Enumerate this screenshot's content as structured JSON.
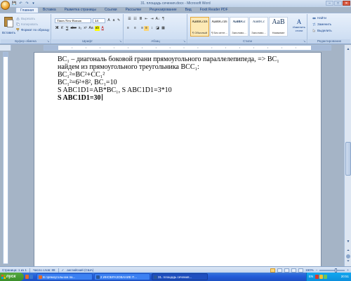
{
  "window": {
    "title": "31. площадь сечения.docx - Microsoft Word",
    "controls": [
      "–",
      "□",
      "✕"
    ]
  },
  "qat": [
    "💾",
    "↶",
    "↷",
    "▾"
  ],
  "tabs": [
    "Главная",
    "Вставка",
    "Разметка страницы",
    "Ссылки",
    "Рассылки",
    "Рецензирование",
    "Вид",
    "Foxit Reader PDF"
  ],
  "ribbon": {
    "clipboard": {
      "label": "Буфер обмена",
      "paste": "Вставить",
      "cut": "Вырезать",
      "copy": "Копировать",
      "format_painter": "Формат по образцу"
    },
    "font": {
      "label": "Шрифт",
      "name": "Times New Roman",
      "size": "14",
      "grow": "A",
      "shrink": "a",
      "clear": "✎",
      "bold": "Ж",
      "italic": "К",
      "underline": "Ч",
      "strike": "abe",
      "subscript": "x₂",
      "superscript": "x²",
      "case": "Aa",
      "highlight": "ab",
      "color": "A"
    },
    "paragraph": {
      "label": "Абзац",
      "bullets": "☰",
      "numbering": "☷",
      "multilevel": "≣",
      "outdent": "⇤",
      "indent": "⇥",
      "sort": "A↓",
      "marks": "¶",
      "align_left": "≡",
      "align_center": "≡",
      "align_right": "≡",
      "justify": "≡",
      "spacing": "↕",
      "shading": "◪",
      "borders": "▦"
    },
    "styles": {
      "label": "Стили",
      "items": [
        {
          "sample": "AaBbCcDı",
          "name": "¶ Обычный"
        },
        {
          "sample": "AaBbCcDı",
          "name": "¶ Без инте..."
        },
        {
          "sample": "AaBbCc",
          "name": "Заголово..."
        },
        {
          "sample": "AaBbCc",
          "name": "Заголово..."
        },
        {
          "sample": "AaB",
          "name": "Название"
        }
      ],
      "change": "Изменить стили",
      "change_icon": "A"
    },
    "editing": {
      "label": "Редактирование",
      "find": "Найти",
      "replace": "Заменить",
      "select": "Выделить"
    }
  },
  "document": {
    "lines": [
      "BC₁ – диагональ боковой грани прямоугольного параллелепипеда, => BC₁",
      "найдем из прямоугольного треугольника BCC₁:",
      "BC₁²=BC²+CC₁²",
      "BC₁²=6²+8², BC₁=10",
      "S ABC1D1=AB*BC₁, S ABC1D1=3*10",
      "S ABC1D1=30"
    ]
  },
  "status": {
    "page": "Страница: 1 из 1",
    "words": "Число слов: 88",
    "lang": "английский (США)",
    "zoom": "150%",
    "zoom_minus": "−",
    "zoom_plus": "+"
  },
  "taskbar": {
    "start": "пуск",
    "tasks": [
      "В прямоугольном па...",
      "2 ИНОБРАЗОВАНИЕ П...",
      "31. площадь сечения..."
    ],
    "lang": "EN",
    "clock": "20:51"
  }
}
